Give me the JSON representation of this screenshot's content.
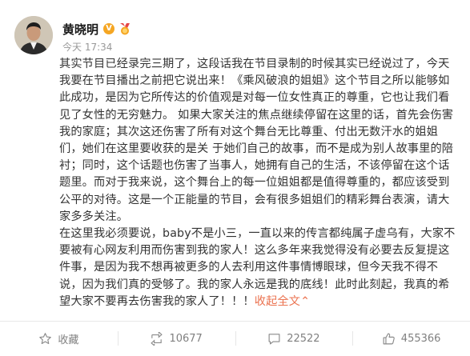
{
  "author": {
    "name": "黄晓明",
    "verified_mark": "V",
    "time": "今天 17:34"
  },
  "content": {
    "paragraph1": "其实节目已经录完三期了，这段话我在节目录制的时候其实已经说过了，今天我要在节目播出之前把它说出来！《乘风破浪的姐姐》这个节目之所以能够如此成功，是因为它所传达的价值观是对每一位女性真正的尊重，它也让我们看见了女性的无穷魅力。 如果大家关注的焦点继续停留在这里的话，首先会伤害我的家庭；其次这还伤害了所有对这个舞台无比尊重、付出无数汗水的姐姐们，她们在这里要收获的是关 于她们自己的故事，而不是成为别人故事里的陪衬；同时，这个话题也伤害了当事人，她拥有自己的生活，不该停留在这个话题里。而对于我来说，这个舞台上的每一位姐姐都是值得尊重的，都应该受到公平的对待。这是一个正能量的节目，会有很多姐姐们的精彩舞台表演，请大家多多关注。",
    "paragraph2": "在这里我必须要说，baby不是小三，一直以来的传言都纯属子虚乌有，大家不要被有心网友利用而伤害到我的家人！这么多年来我觉得没有必要去反复提这件事，是因为我不想再被更多的人去利用这件事情博眼球，但今天我不得不说，因为我们真的受够了。我的家人永远是我的底线！此时此刻起，我真的希望大家不要再去伤害我的家人了！！！",
    "collapse_label": "收起全文",
    "collapse_arrow": "⌃"
  },
  "actions": {
    "favorite_label": "收藏",
    "repost_count": "10677",
    "comment_count": "22522",
    "like_count": "455366"
  },
  "colors": {
    "link": "#eb7350",
    "badge": "#f5a623",
    "muted": "#999999"
  },
  "icons": [
    "avatar",
    "verified-v-icon",
    "medal-icon",
    "star-icon",
    "repost-icon",
    "comment-icon",
    "thumbs-up-icon"
  ]
}
